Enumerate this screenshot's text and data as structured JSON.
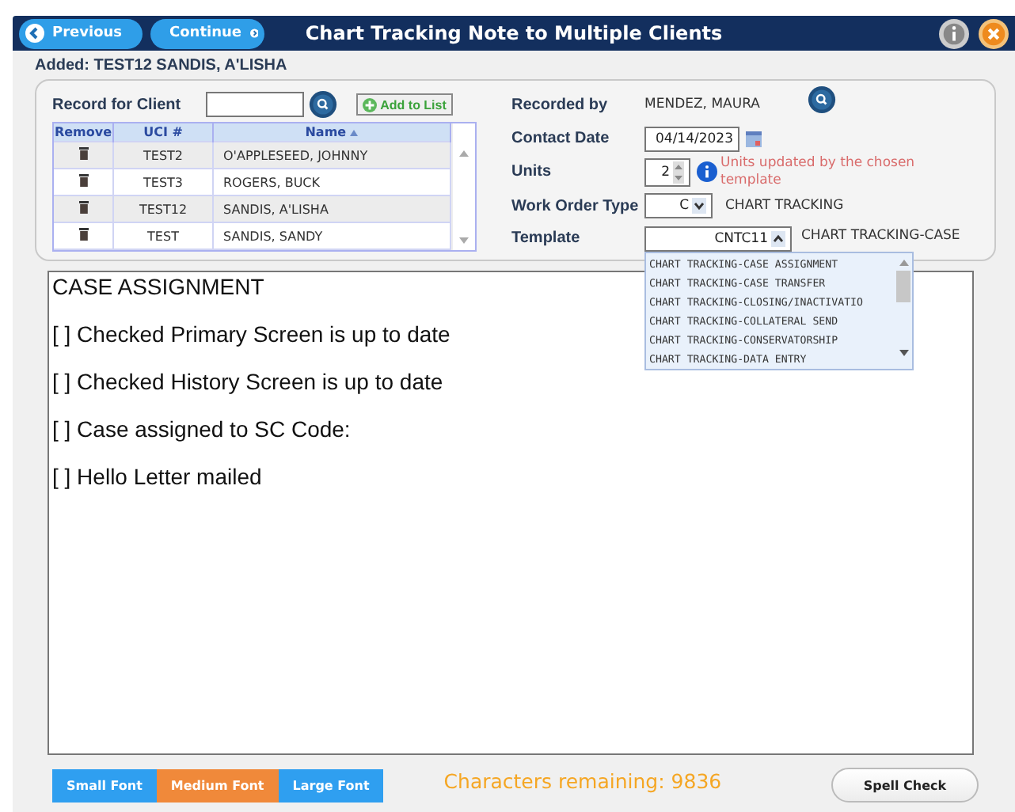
{
  "header": {
    "previous": "Previous",
    "continue": "Continue",
    "title": "Chart Tracking Note to Multiple Clients"
  },
  "added": "Added: TEST12 SANDIS, A'LISHA",
  "client_search": {
    "label": "Record for Client",
    "add_button": "Add to List"
  },
  "clients_table": {
    "columns": [
      "Remove",
      "UCI #",
      "Name"
    ],
    "rows": [
      {
        "uci": "TEST2",
        "name": "O'APPLESEED, JOHNNY"
      },
      {
        "uci": "TEST3",
        "name": "ROGERS, BUCK"
      },
      {
        "uci": "TEST12",
        "name": "SANDIS, A'LISHA"
      },
      {
        "uci": "TEST",
        "name": "SANDIS, SANDY"
      }
    ]
  },
  "form": {
    "recorded_by_label": "Recorded by",
    "recorded_by": "MENDEZ, MAURA",
    "contact_date_label": "Contact Date",
    "contact_date": "04/14/2023",
    "units_label": "Units",
    "units": "2",
    "units_note": "Units updated by the chosen template",
    "work_order_label": "Work Order Type",
    "work_order": "C",
    "work_order_desc": "CHART TRACKING",
    "template_label": "Template",
    "template": "CNTC11",
    "template_desc": "CHART TRACKING-CASE"
  },
  "template_options": [
    "CHART TRACKING-CASE ASSIGNMENT",
    "CHART TRACKING-CASE TRANSFER",
    "CHART TRACKING-CLOSING/INACTIVATIO",
    "CHART TRACKING-COLLATERAL SEND",
    "CHART TRACKING-CONSERVATORSHIP",
    "CHART TRACKING-DATA ENTRY"
  ],
  "note_lines": [
    "CASE ASSIGNMENT",
    "[ ] Checked Primary Screen is up to date",
    "[ ] Checked History Screen is up to date",
    "[ ] Case assigned to SC Code:",
    "[ ] Hello Letter mailed"
  ],
  "font_buttons": [
    {
      "label": "Small Font",
      "selected": false
    },
    {
      "label": "Medium Font",
      "selected": true
    },
    {
      "label": "Large Font",
      "selected": false
    }
  ],
  "chars_remaining": "Characters remaining: 9836",
  "spell_check": "Spell Check"
}
